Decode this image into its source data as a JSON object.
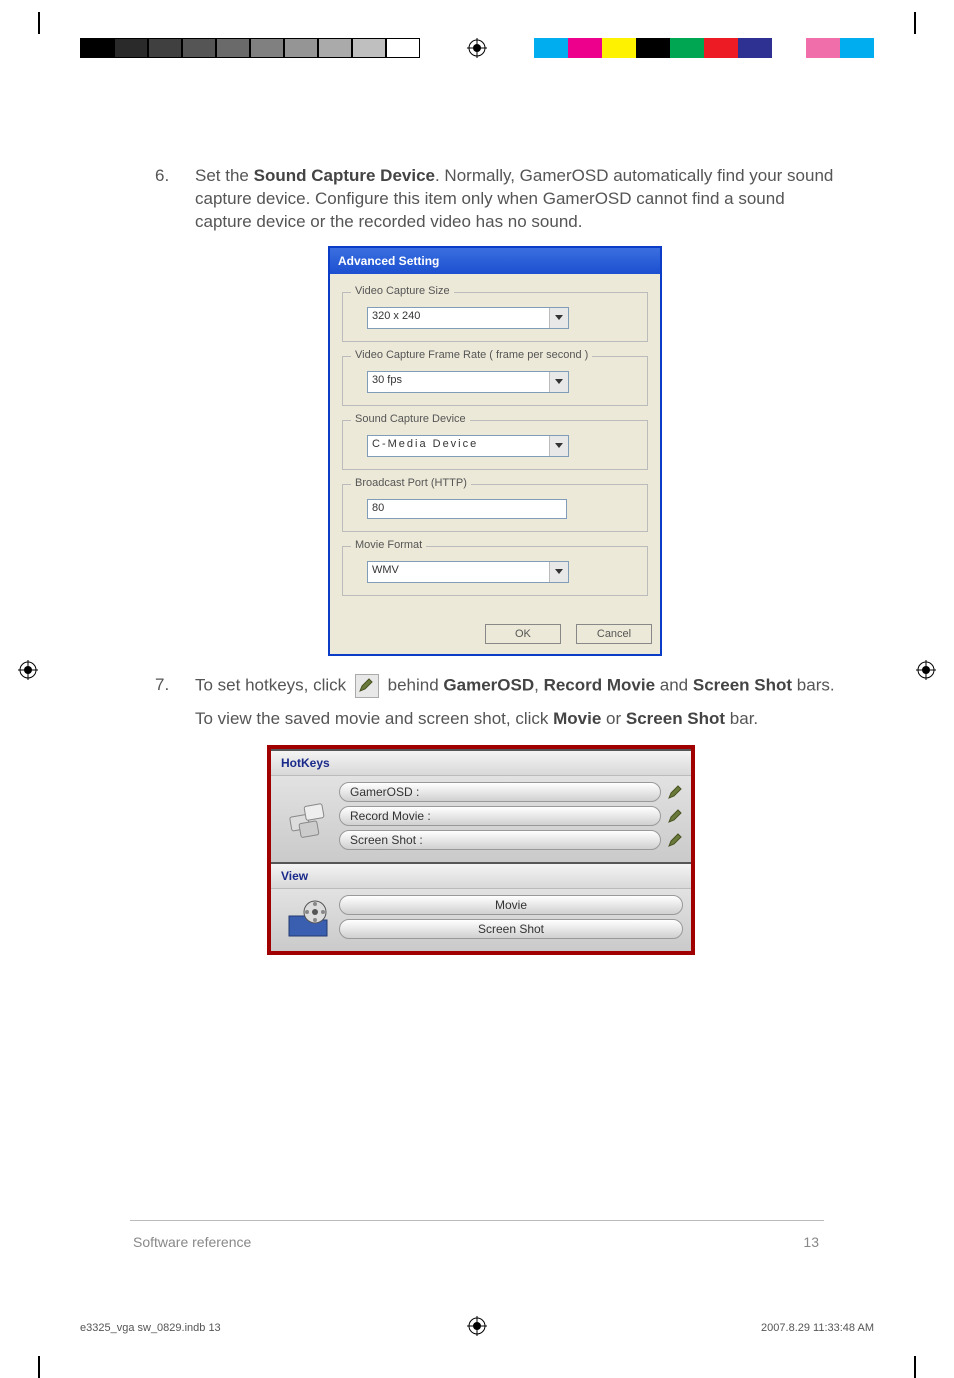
{
  "instructions": {
    "item6": {
      "num": "6.",
      "text_a": "Set the ",
      "text_bold": "Sound Capture Device",
      "text_b": ". Normally, GamerOSD automatically find your sound capture device. Configure this item only when GamerOSD cannot find a sound capture device or the recorded video has no sound."
    },
    "item7": {
      "num": "7.",
      "text_a": "To set hotkeys, click ",
      "text_b": " behind ",
      "b1": "GamerOSD",
      "sep": ", ",
      "b2": "Record Movie",
      "text_c": " and ",
      "b3": "Screen Shot",
      "text_d": " bars.",
      "follow_a": "To view the saved movie and screen shot, click ",
      "fb1": "Movie",
      "follow_b": " or ",
      "fb2": "Screen Shot",
      "follow_c": " bar."
    }
  },
  "dialog": {
    "title": "Advanced Setting",
    "groups": {
      "vcs": {
        "legend": "Video Capture Size",
        "value": "320 x 240"
      },
      "fps": {
        "legend": "Video Capture Frame Rate ( frame per second )",
        "value": "30 fps"
      },
      "snd": {
        "legend": "Sound Capture Device",
        "value": "C-Media Device"
      },
      "port": {
        "legend": "Broadcast Port (HTTP)",
        "value": "80"
      },
      "fmt": {
        "legend": "Movie Format",
        "value": "WMV"
      }
    },
    "buttons": {
      "ok": "OK",
      "cancel": "Cancel"
    }
  },
  "panel": {
    "hotkeys": {
      "title": "HotKeys",
      "items": {
        "a": "GamerOSD :",
        "b": "Record Movie :",
        "c": "Screen Shot :"
      }
    },
    "view": {
      "title": "View",
      "items": {
        "a": "Movie",
        "b": "Screen Shot"
      }
    }
  },
  "footer": {
    "left": "Software reference",
    "right": "13",
    "print_l": "e3325_vga sw_0829.indb   13",
    "print_r": "2007.8.29   11:33:48 AM"
  },
  "swatches_gray": [
    "#000",
    "#2a2a2a",
    "#404040",
    "#555",
    "#6a6a6a",
    "#808080",
    "#959595",
    "#aaa",
    "#bfbfbf",
    "#fff"
  ],
  "swatches_color": [
    "#00aeef",
    "#ec008c",
    "#fff200",
    "#000",
    "#00a651",
    "#ed1c24",
    "#2e3192",
    "#fff",
    "#f06eaa",
    "#00aeef"
  ]
}
